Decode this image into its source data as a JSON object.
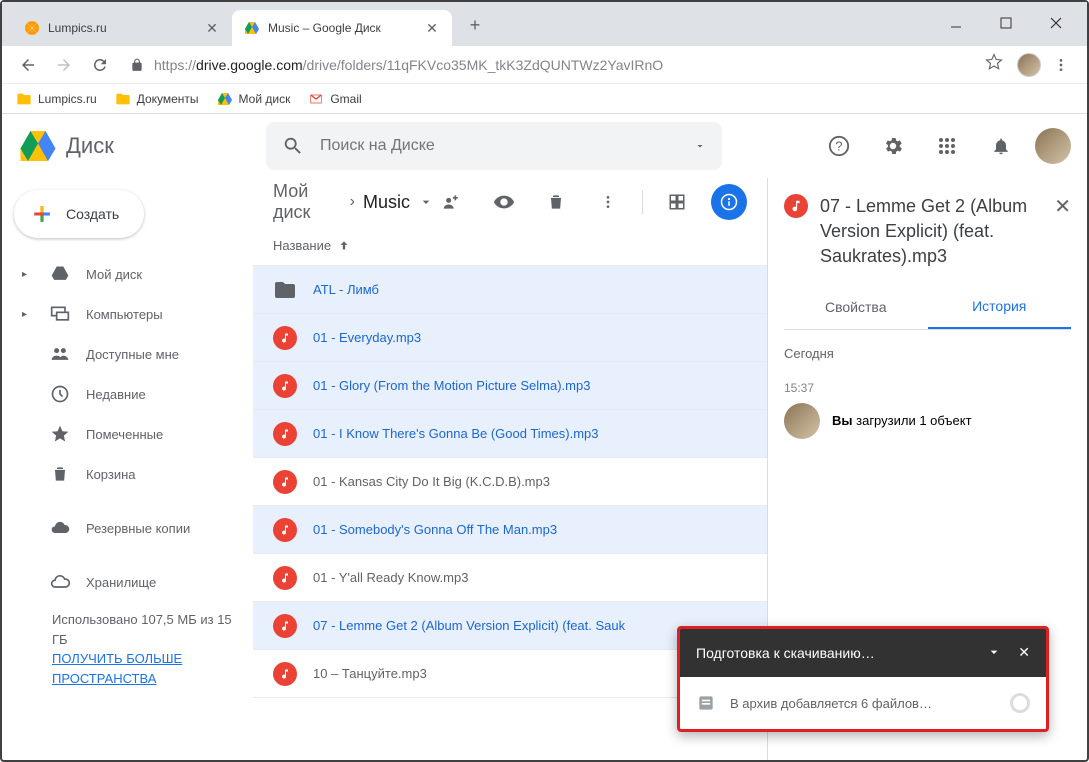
{
  "browser": {
    "tabs": [
      {
        "title": "Lumpics.ru",
        "favicon": "orange"
      },
      {
        "title": "Music – Google Диск",
        "favicon": "drive"
      }
    ],
    "url_protocol": "https://",
    "url_host": "drive.google.com",
    "url_path": "/drive/folders/11qFKVco35MK_tkK3ZdQUNTWz2YavIRnO"
  },
  "bookmarks": [
    {
      "label": "Lumpics.ru",
      "icon": "folder-yellow"
    },
    {
      "label": "Документы",
      "icon": "folder-yellow"
    },
    {
      "label": "Мой диск",
      "icon": "drive"
    },
    {
      "label": "Gmail",
      "icon": "gmail"
    }
  ],
  "app": {
    "name": "Диск",
    "search_placeholder": "Поиск на Диске",
    "create_label": "Создать"
  },
  "sidebar": {
    "items": [
      {
        "label": "Мой диск",
        "icon": "drive-dark",
        "expandable": true
      },
      {
        "label": "Компьютеры",
        "icon": "computers",
        "expandable": true
      },
      {
        "label": "Доступные мне",
        "icon": "shared"
      },
      {
        "label": "Недавние",
        "icon": "recent"
      },
      {
        "label": "Помеченные",
        "icon": "star"
      },
      {
        "label": "Корзина",
        "icon": "trash"
      },
      {
        "label": "Резервные копии",
        "icon": "cloud-filled"
      },
      {
        "label": "Хранилище",
        "icon": "cloud-outline"
      }
    ],
    "storage_used": "Использовано 107,5 МБ из 15 ГБ",
    "storage_cta": "ПОЛУЧИТЬ БОЛЬШЕ ПРОСТРАНСТВА"
  },
  "breadcrumb": {
    "root": "Мой диск",
    "current": "Music"
  },
  "columns": {
    "name": "Название"
  },
  "files": [
    {
      "name": "ATL - Лимб",
      "type": "folder",
      "selected": true
    },
    {
      "name": "01 - Everyday.mp3",
      "type": "music",
      "selected": true
    },
    {
      "name": "01 - Glory (From the Motion Picture Selma).mp3",
      "type": "music",
      "selected": true
    },
    {
      "name": "01 - I Know There's Gonna Be (Good Times).mp3",
      "type": "music",
      "selected": true
    },
    {
      "name": "01 - Kansas City Do It Big (K.C.D.B).mp3",
      "type": "music",
      "selected": false
    },
    {
      "name": "01 - Somebody's Gonna Off The Man.mp3",
      "type": "music",
      "selected": true
    },
    {
      "name": "01 - Y'all Ready Know.mp3",
      "type": "music",
      "selected": false
    },
    {
      "name": "07 - Lemme Get 2 (Album Version Explicit) (feat. Sauk",
      "type": "music",
      "selected": true
    },
    {
      "name": "10 – Танцуйте.mp3",
      "type": "music",
      "selected": false
    }
  ],
  "details": {
    "title": "07 - Lemme Get 2 (Album Version Explicit) (feat. Saukrates).mp3",
    "tab_properties": "Свойства",
    "tab_history": "История",
    "history": {
      "section": "Сегодня",
      "time": "15:37",
      "you": "Вы",
      "action": "загрузили 1 объект"
    }
  },
  "toast": {
    "title": "Подготовка к скачиванию…",
    "body": "В архив добавляется 6 файлов…"
  }
}
